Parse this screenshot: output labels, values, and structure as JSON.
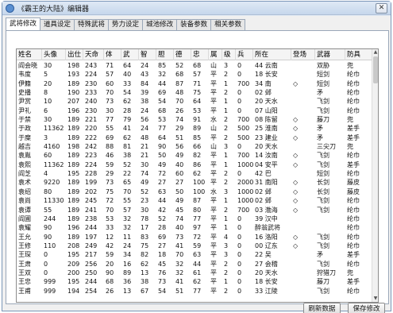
{
  "window": {
    "title": "《霸王的大陆》编辑器",
    "close_glyph": "✕"
  },
  "tabs": [
    "武将修改",
    "道具设定",
    "特殊武将",
    "势力设定",
    "城池修改",
    "装备参数",
    "相关参数"
  ],
  "active_tab": 0,
  "table": {
    "columns": [
      "姓名",
      "头像",
      "出仕",
      "天命",
      "体",
      "武",
      "智",
      "胆",
      "德",
      "忠",
      "属",
      "级",
      "兵",
      "所在",
      "登场",
      "武器",
      "防具"
    ],
    "rows": [
      [
        "阎会晓",
        "30",
        "198",
        "243",
        "71",
        "64",
        "24",
        "85",
        "52",
        "68",
        "山",
        "3",
        "0",
        "44 云南",
        "",
        "双胁",
        "兜"
      ],
      [
        "韦度",
        "5",
        "193",
        "224",
        "57",
        "40",
        "43",
        "32",
        "68",
        "57",
        "平",
        "2",
        "0",
        "18 长安",
        "",
        "短剑",
        "纶巾"
      ],
      [
        "伊籍",
        "20",
        "189",
        "230",
        "60",
        "33",
        "84",
        "44",
        "87",
        "71",
        "平",
        "1",
        "700",
        "34 南",
        "◇",
        "短剑",
        "纶巾"
      ],
      [
        "史播",
        "8",
        "190",
        "233",
        "70",
        "54",
        "39",
        "69",
        "48",
        "75",
        "平",
        "2",
        "0",
        "02 邺",
        "",
        "矛",
        "纶巾"
      ],
      [
        "尹赏",
        "10",
        "207",
        "240",
        "73",
        "62",
        "38",
        "54",
        "70",
        "64",
        "平",
        "1",
        "0",
        "20 天水",
        "",
        "飞剑",
        "纶巾"
      ],
      [
        "尹礼",
        "6",
        "196",
        "230",
        "30",
        "28",
        "24",
        "68",
        "26",
        "53",
        "平",
        "1",
        "0",
        "07 山阳",
        "",
        "飞剑",
        "纶巾"
      ],
      [
        "于禁",
        "30",
        "189",
        "221",
        "77",
        "79",
        "56",
        "53",
        "74",
        "91",
        "水",
        "2",
        "700",
        "08 陈留",
        "◇",
        "藤刀",
        "兜"
      ],
      [
        "于政",
        "11362",
        "189",
        "220",
        "55",
        "41",
        "24",
        "77",
        "29",
        "89",
        "山",
        "2",
        "500",
        "25 淮南",
        "◇",
        "矛",
        "差手"
      ],
      [
        "于糜",
        "3",
        "189",
        "222",
        "69",
        "62",
        "48",
        "64",
        "51",
        "85",
        "平",
        "2",
        "500",
        "23 建业",
        "◇",
        "矛",
        "差手"
      ],
      [
        "越吉",
        "4160",
        "198",
        "242",
        "88",
        "81",
        "21",
        "90",
        "56",
        "66",
        "山",
        "3",
        "0",
        "20 天水",
        "",
        "三尖刀",
        "兜"
      ],
      [
        "袁胤",
        "60",
        "189",
        "223",
        "46",
        "38",
        "21",
        "50",
        "49",
        "82",
        "平",
        "1",
        "700",
        "14 汝南",
        "◇",
        "飞剑",
        "纶巾"
      ],
      [
        "袁熙",
        "11362",
        "189",
        "224",
        "59",
        "52",
        "30",
        "49",
        "40",
        "86",
        "平",
        "1",
        "1000",
        "04 安平",
        "◇",
        "飞剑",
        "差手"
      ],
      [
        "阎芝",
        "4",
        "195",
        "228",
        "29",
        "22",
        "74",
        "72",
        "60",
        "62",
        "平",
        "2",
        "0",
        "42 巴",
        "",
        "短剑",
        "纶巾"
      ],
      [
        "袁术",
        "9220",
        "189",
        "199",
        "73",
        "65",
        "49",
        "27",
        "27",
        "100",
        "平",
        "2",
        "2000",
        "31 南阳",
        "◇",
        "长剑",
        "藤皮"
      ],
      [
        "袁绍",
        "80",
        "189",
        "202",
        "75",
        "70",
        "52",
        "63",
        "50",
        "100",
        "水",
        "3",
        "1000",
        "02 邺",
        "◇",
        "长剑",
        "藤皮"
      ],
      [
        "袁尚",
        "11330",
        "189",
        "245",
        "72",
        "55",
        "23",
        "44",
        "49",
        "87",
        "平",
        "1",
        "1000",
        "02 邺",
        "◇",
        "飞剑",
        "纶巾"
      ],
      [
        "袁谭",
        "55",
        "189",
        "241",
        "70",
        "57",
        "30",
        "42",
        "45",
        "80",
        "平",
        "2",
        "700",
        "03 渤海",
        "◇",
        "飞剑",
        "纶巾"
      ],
      [
        "阎圃",
        "244",
        "189",
        "238",
        "53",
        "32",
        "78",
        "52",
        "74",
        "77",
        "平",
        "1",
        "0",
        "39 汉中",
        "",
        "",
        "纶巾"
      ],
      [
        "袁耀",
        "90",
        "196",
        "244",
        "33",
        "32",
        "17",
        "28",
        "40",
        "97",
        "平",
        "1",
        "0",
        "醉翁武将",
        "",
        "",
        "纶巾"
      ],
      [
        "王允",
        "90",
        "189",
        "197",
        "12",
        "11",
        "83",
        "69",
        "73",
        "72",
        "平",
        "4",
        "0",
        "16 洛阳",
        "◇",
        "飞剑",
        "纶巾"
      ],
      [
        "王修",
        "110",
        "208",
        "249",
        "42",
        "24",
        "75",
        "27",
        "41",
        "59",
        "平",
        "3",
        "0",
        "00 辽东",
        "◇",
        "飞剑",
        "纶巾"
      ],
      [
        "王琛",
        "0",
        "195",
        "217",
        "59",
        "34",
        "82",
        "18",
        "70",
        "63",
        "平",
        "3",
        "0",
        "22 吴",
        "",
        "矛",
        "差手"
      ],
      [
        "王肃",
        "0",
        "209",
        "256",
        "20",
        "16",
        "62",
        "45",
        "32",
        "44",
        "平",
        "2",
        "0",
        "27 会稽",
        "",
        "飞剑",
        "纶巾"
      ],
      [
        "王双",
        "0",
        "200",
        "250",
        "90",
        "89",
        "13",
        "76",
        "32",
        "61",
        "平",
        "2",
        "0",
        "20 天水",
        "",
        "狩猎刀",
        "兜"
      ],
      [
        "王忠",
        "999",
        "195",
        "244",
        "68",
        "36",
        "38",
        "73",
        "41",
        "62",
        "平",
        "1",
        "0",
        "18 长安",
        "",
        "藤刀",
        "差手"
      ],
      [
        "王甫",
        "999",
        "194",
        "254",
        "26",
        "13",
        "67",
        "54",
        "51",
        "77",
        "平",
        "2",
        "0",
        "33 江陵",
        "",
        "飞剑",
        "纶巾"
      ]
    ]
  },
  "scrollbar": {
    "up": "▲",
    "down": "▼"
  },
  "buttons": {
    "refresh": "刷新数据",
    "save": "保存修改"
  }
}
